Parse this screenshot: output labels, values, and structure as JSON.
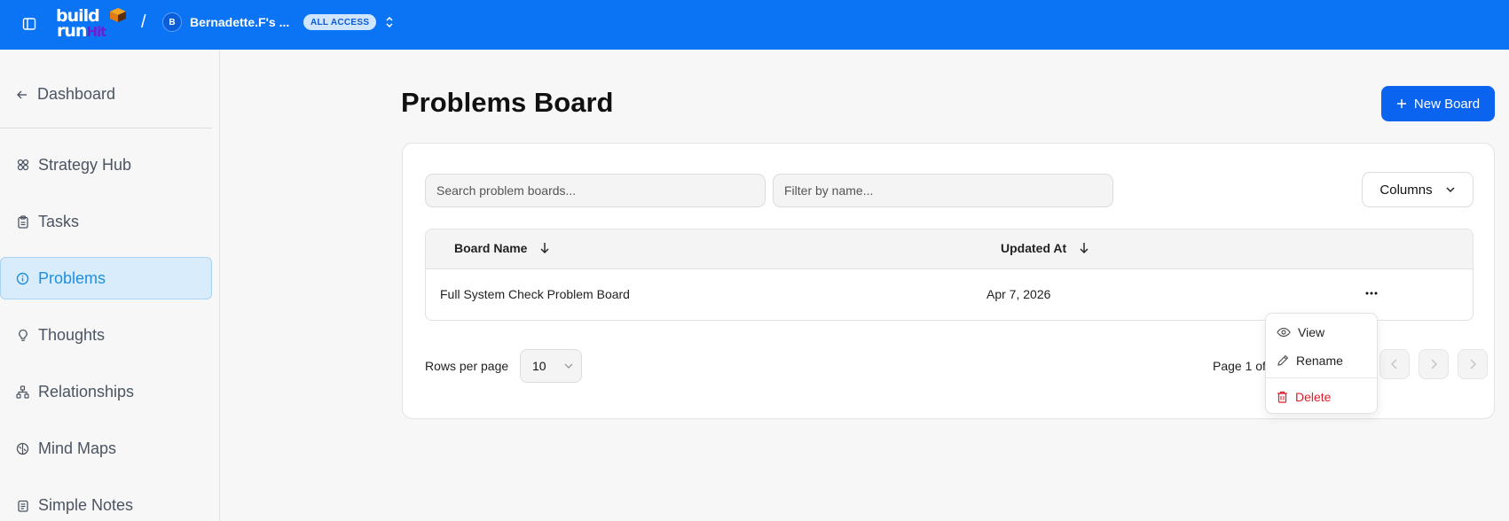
{
  "topbar": {
    "logo_line1": "build",
    "logo_line2": "run",
    "logo_hit": "Hit",
    "separator": "/",
    "workspace_initial": "B",
    "workspace_name": "Bernadette.F's ...",
    "access_badge": "ALL ACCESS",
    "brand_color": "#0a74f5"
  },
  "sidebar": {
    "back_label": "Dashboard",
    "items": [
      {
        "label": "Strategy Hub",
        "icon": "strategy-icon"
      },
      {
        "label": "Tasks",
        "icon": "clipboard-icon"
      },
      {
        "label": "Problems",
        "icon": "info-circle-icon",
        "active": true
      },
      {
        "label": "Thoughts",
        "icon": "lightbulb-icon"
      },
      {
        "label": "Relationships",
        "icon": "network-icon"
      },
      {
        "label": "Mind Maps",
        "icon": "brain-icon"
      },
      {
        "label": "Simple Notes",
        "icon": "notes-icon"
      }
    ]
  },
  "main": {
    "title": "Problems Board",
    "new_board_label": "New Board",
    "search_placeholder": "Search problem boards...",
    "filter_placeholder": "Filter by name...",
    "columns_label": "Columns",
    "table": {
      "headers": [
        "Board Name",
        "Updated At"
      ],
      "rows": [
        {
          "name": "Full System Check Problem Board",
          "updated": "Apr 7, 2026"
        }
      ]
    },
    "rows_per_page_label": "Rows per page",
    "rows_per_page_value": "10",
    "page_info": "Page 1 of"
  },
  "row_menu": {
    "items": [
      "View",
      "Rename",
      "Delete"
    ]
  },
  "colors": {
    "accent": "#0a64f0",
    "active_nav_bg": "#d9ecfb",
    "danger": "#e11d2a"
  }
}
